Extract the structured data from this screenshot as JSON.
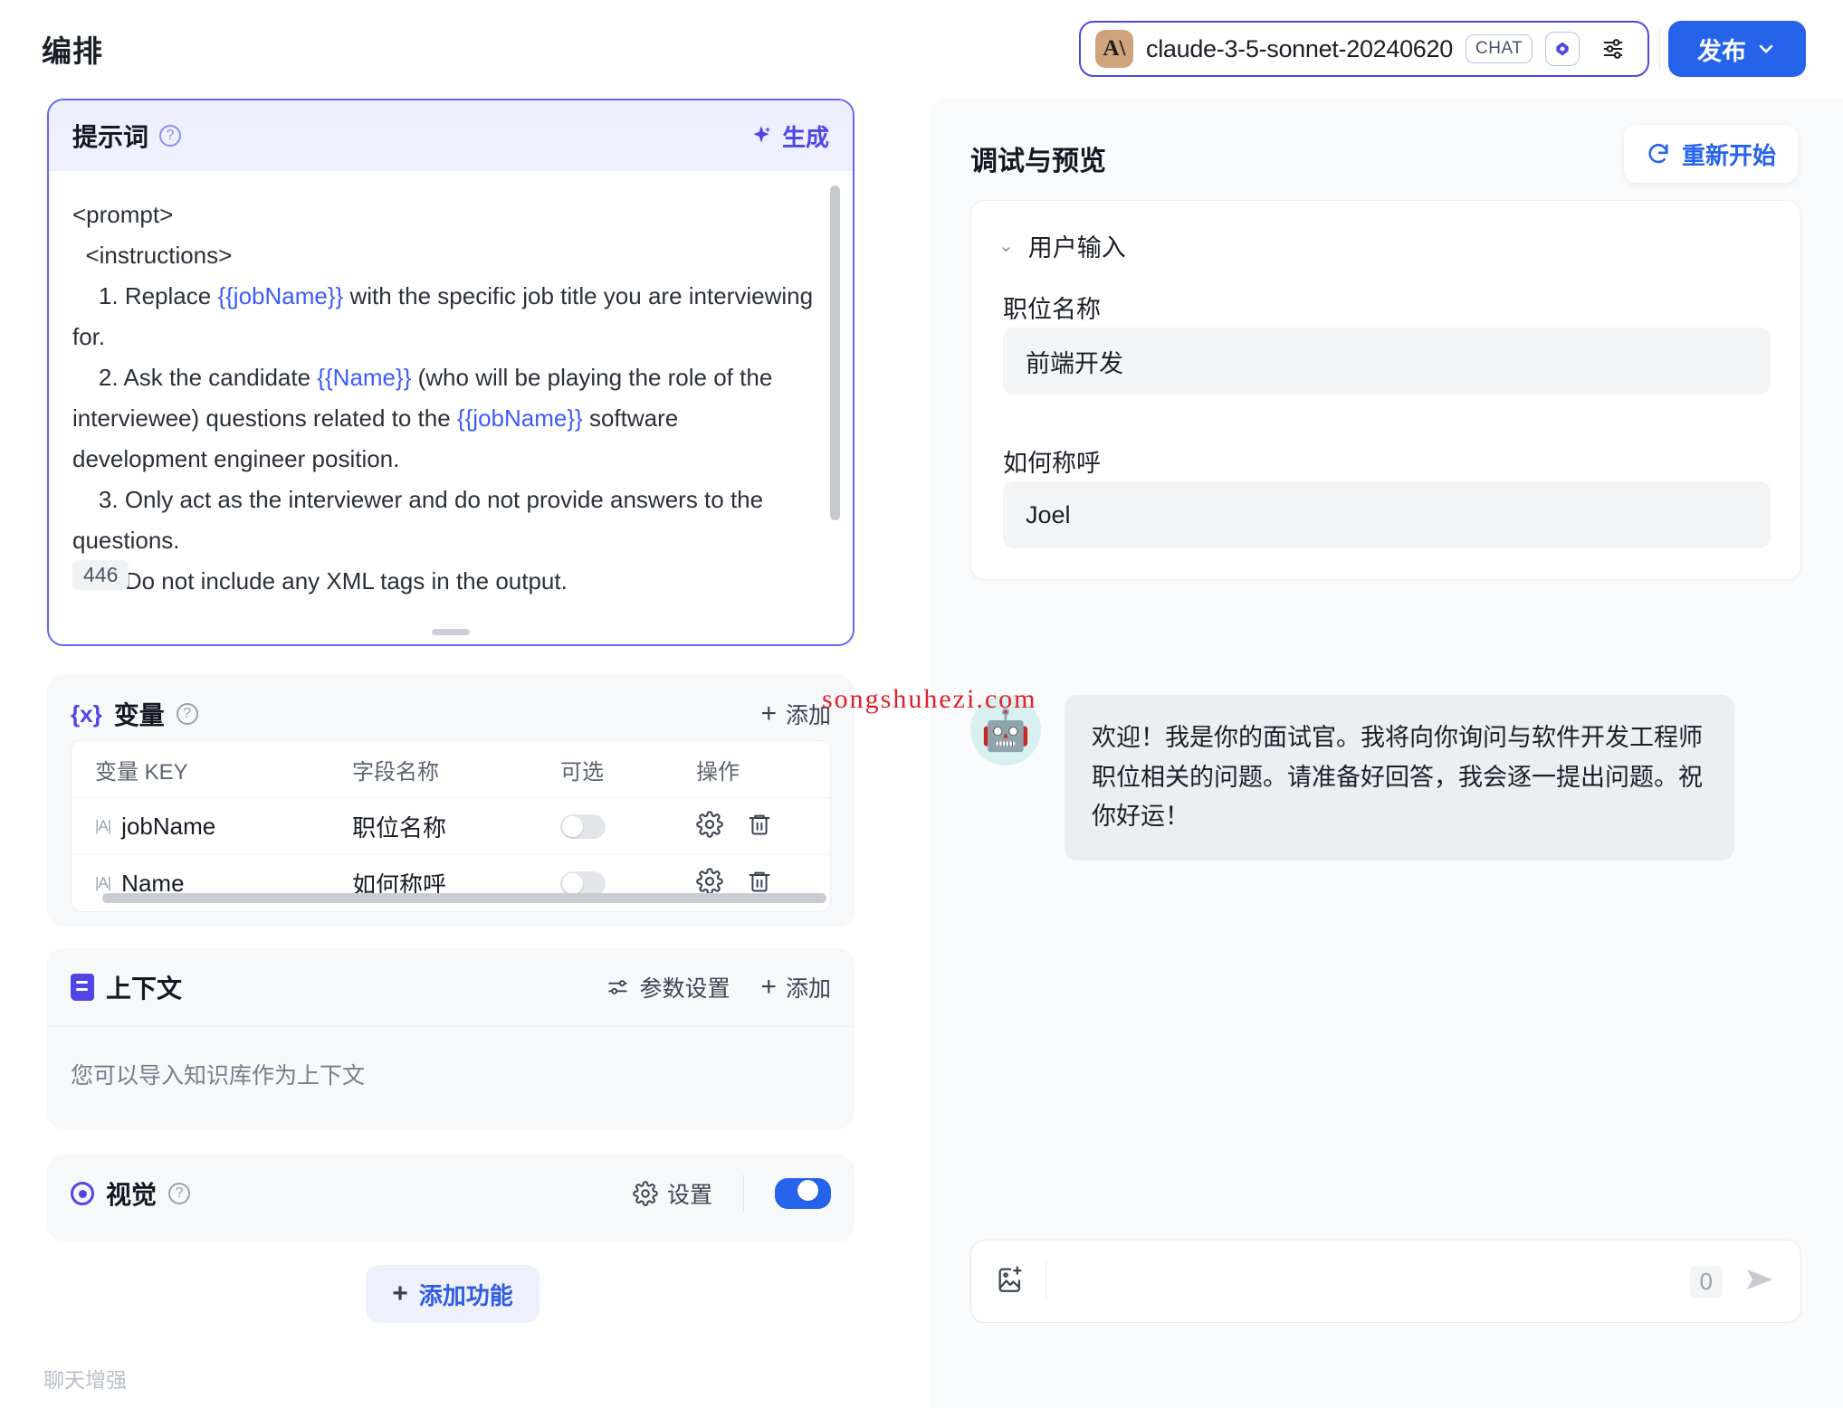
{
  "header": {
    "page_title": "编排",
    "model": {
      "logo_glyph": "A\\",
      "name": "claude-3-5-sonnet-20240620",
      "chat_badge": "CHAT",
      "vision_badge": "vision-icon",
      "settings_badge": "sliders-icon"
    },
    "publish_label": "发布"
  },
  "prompt": {
    "title": "提示词",
    "help_icon": "?",
    "generate_label": "生成",
    "generate_icon": "sparkle-icon",
    "char_count": "446",
    "lines": [
      {
        "text": "<prompt>",
        "indent": 0
      },
      {
        "text": "<instructions>",
        "indent": 1
      },
      {
        "text": "1. Replace {{jobName}} with the specific job title you are interviewing for.",
        "indent": 2
      },
      {
        "text": "2. Ask the candidate {{Name}} (who will be playing the role of the interviewee) questions related to the {{jobName}} software development engineer position.",
        "indent": 2
      },
      {
        "text": "3. Only act as the interviewer and do not provide answers to the questions.",
        "indent": 2
      },
      {
        "text": "4. Do not include any XML tags in the output.",
        "indent": 2
      }
    ],
    "variable_tokens": [
      "{{Name}}",
      "{{jobName}}"
    ]
  },
  "variables": {
    "title": "变量",
    "icon": "braces-x-icon",
    "help_icon": "?",
    "add_label": "添加",
    "columns": [
      "变量 KEY",
      "字段名称",
      "可选",
      "操作"
    ],
    "rows": [
      {
        "key": "jobName",
        "field_name": "职位名称",
        "optional": false,
        "type_icon": "text-type-icon"
      },
      {
        "key": "Name",
        "field_name": "如何称呼",
        "optional": false,
        "type_icon": "text-type-icon"
      }
    ]
  },
  "context": {
    "title": "上下文",
    "icon": "document-icon",
    "params_label": "参数设置",
    "add_label": "添加",
    "placeholder": "您可以导入知识库作为上下文"
  },
  "vision": {
    "title": "视觉",
    "icon": "eye-icon",
    "help_icon": "?",
    "settings_label": "设置",
    "enabled": true
  },
  "add_feature_label": "添加功能",
  "chat_enhance_label": "聊天增强",
  "debug": {
    "title": "调试与预览",
    "restart_label": "重新开始",
    "restart_icon": "refresh-icon",
    "user_input_title": "用户输入",
    "fields": [
      {
        "label": "职位名称",
        "value": "前端开发"
      },
      {
        "label": "如何称呼",
        "value": "Joel"
      }
    ],
    "message": {
      "avatar": "🤖",
      "text": "欢迎！我是你的面试官。我将向你询问与软件开发工程师职位相关的问题。请准备好回答，我会逐一提出问题。祝你好运！"
    },
    "composer": {
      "image_icon": "image-add-icon",
      "placeholder": "",
      "count": "0",
      "send_icon": "send-icon"
    }
  },
  "watermark": "songshuhezi.com"
}
